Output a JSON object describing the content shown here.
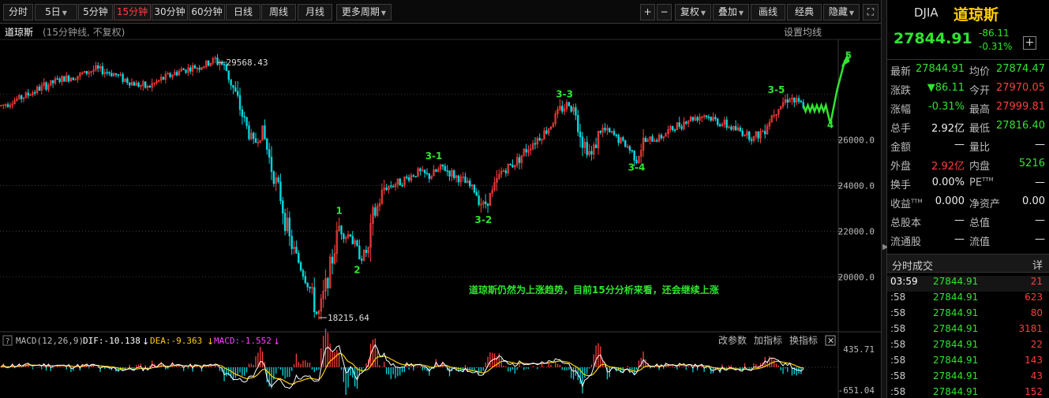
{
  "toolbar": {
    "buttons": [
      "分时",
      "5日",
      "5分钟",
      "15分钟",
      "30分钟",
      "60分钟",
      "日线",
      "周线",
      "月线",
      "更多周期"
    ],
    "right": [
      "+",
      "−",
      "复权",
      "叠加",
      "画线",
      "经典",
      "隐藏"
    ]
  },
  "chart": {
    "title": "道琼斯",
    "sub": "(15分钟线, 不复权)",
    "set_ma": "设置均线"
  },
  "chart_data": {
    "type": "candlestick",
    "y_ticks": [
      "26000.0",
      "24000.0",
      "22000.0",
      "20000.0"
    ],
    "ylim": [
      17700,
      30300
    ],
    "high_label": "29568.43",
    "low_label": "18215.64",
    "path": [
      [
        0,
        27500
      ],
      [
        5,
        27700
      ],
      [
        10,
        27900
      ],
      [
        18,
        28300
      ],
      [
        25,
        28600
      ],
      [
        35,
        28850
      ],
      [
        42,
        29100
      ],
      [
        50,
        28900
      ],
      [
        58,
        28500
      ],
      [
        65,
        28300
      ],
      [
        72,
        28700
      ],
      [
        80,
        29050
      ],
      [
        90,
        29250
      ],
      [
        96,
        29568
      ],
      [
        100,
        29050
      ],
      [
        104,
        28000
      ],
      [
        108,
        26800
      ],
      [
        112,
        25800
      ],
      [
        116,
        26400
      ],
      [
        120,
        24800
      ],
      [
        124,
        23500
      ],
      [
        128,
        21600
      ],
      [
        131,
        20900
      ],
      [
        134,
        20200
      ],
      [
        137,
        19500
      ],
      [
        140,
        18400
      ],
      [
        141,
        18216
      ],
      [
        144,
        19600
      ],
      [
        147,
        20800
      ],
      [
        150,
        22200
      ],
      [
        153,
        21800
      ],
      [
        155,
        21900
      ],
      [
        157,
        21300
      ],
      [
        160,
        20900
      ],
      [
        163,
        21200
      ],
      [
        165,
        22500
      ],
      [
        170,
        23900
      ],
      [
        178,
        24200
      ],
      [
        185,
        24600
      ],
      [
        190,
        24400
      ],
      [
        196,
        24800
      ],
      [
        200,
        24500
      ],
      [
        205,
        24200
      ],
      [
        210,
        23800
      ],
      [
        214,
        23100
      ],
      [
        218,
        23700
      ],
      [
        222,
        24600
      ],
      [
        228,
        25000
      ],
      [
        235,
        25800
      ],
      [
        242,
        26400
      ],
      [
        248,
        27300
      ],
      [
        252,
        27600
      ],
      [
        255,
        27200
      ],
      [
        258,
        26000
      ],
      [
        262,
        25300
      ],
      [
        266,
        26500
      ],
      [
        272,
        26200
      ],
      [
        278,
        25700
      ],
      [
        282,
        25200
      ],
      [
        285,
        25900
      ],
      [
        292,
        26100
      ],
      [
        298,
        26500
      ],
      [
        305,
        26900
      ],
      [
        312,
        27100
      ],
      [
        318,
        26800
      ],
      [
        325,
        26500
      ],
      [
        330,
        26300
      ],
      [
        334,
        26100
      ],
      [
        338,
        26400
      ],
      [
        344,
        27400
      ],
      [
        350,
        27900
      ],
      [
        352,
        27700
      ],
      [
        356,
        27500
      ]
    ],
    "wave_labels": [
      {
        "t": "1",
        "i": 150,
        "v": 22900
      },
      {
        "t": "2",
        "i": 158,
        "v": 20300
      },
      {
        "t": "3-1",
        "i": 192,
        "v": 25300
      },
      {
        "t": "3-2",
        "i": 214,
        "v": 22500
      },
      {
        "t": "3-3",
        "i": 250,
        "v": 28000
      },
      {
        "t": "3-4",
        "i": 282,
        "v": 24800
      },
      {
        "t": "3-5",
        "i": 344,
        "v": 28200
      },
      {
        "t": "4",
        "i": 368,
        "v": 26650
      },
      {
        "t": "5",
        "i": 376,
        "v": 29700
      }
    ],
    "annotation": "道琼斯仍然为上涨趋势，目前15分分析来看，还会继续上涨",
    "macd": {
      "label": "MACD(12,26,9)",
      "dif": "DIF:-10.138",
      "dea": "DEA:-9.363",
      "macd": "MACD:-1.552",
      "top": "435.71",
      "bottom": "-651.04"
    }
  },
  "macd_ctrl": [
    "改参数",
    "加指标",
    "换指标"
  ],
  "quote": {
    "code": "DJIA",
    "name": "道琼斯",
    "price": "27844.91",
    "chg": "-86.11",
    "pct": "-0.31%",
    "plus": "+"
  },
  "stats": [
    {
      "l1": "最新",
      "v1": "27844.91",
      "c1": "g",
      "l2": "均价",
      "v2": "27874.47",
      "c2": "g"
    },
    {
      "l1": "涨跌",
      "v1": "▼86.11",
      "c1": "g",
      "l2": "今开",
      "v2": "27970.05",
      "c2": "r"
    },
    {
      "l1": "涨幅",
      "v1": "-0.31%",
      "c1": "g",
      "l2": "最高",
      "v2": "27999.81",
      "c2": "r"
    },
    {
      "l1": "总手",
      "v1": "2.92亿",
      "c1": "w",
      "l2": "最低",
      "v2": "27816.40",
      "c2": "g"
    },
    {
      "l1": "金额",
      "v1": "—",
      "c1": "w",
      "l2": "量比",
      "v2": "—",
      "c2": "w"
    },
    {
      "l1": "外盘",
      "v1": "2.92亿",
      "c1": "r",
      "l2": "内盘",
      "v2": "5216",
      "c2": "g"
    },
    {
      "l1": "换手",
      "v1": "0.00%",
      "c1": "w",
      "l2": "PE",
      "v2": "—",
      "c2": "w"
    },
    {
      "l1": "收益",
      "v1": "0.000",
      "c1": "w",
      "l2": "净资产",
      "v2": "0.00",
      "c2": "w"
    },
    {
      "l1": "总股本",
      "v1": "—",
      "c1": "w",
      "l2": "总值",
      "v2": "—",
      "c2": "w"
    },
    {
      "l1": "流通股",
      "v1": "—",
      "c1": "w",
      "l2": "流值",
      "v2": "—",
      "c2": "w"
    }
  ],
  "ttm": "TTM",
  "trades_title": "分时成交",
  "trades_detail": "详",
  "trades": [
    {
      "t": "03:59",
      "p": "27844.91",
      "v": "21",
      "c": "r"
    },
    {
      "t": ":58",
      "p": "27844.91",
      "v": "623",
      "c": "r"
    },
    {
      "t": ":58",
      "p": "27844.91",
      "v": "80",
      "c": "r"
    },
    {
      "t": ":58",
      "p": "27844.91",
      "v": "3181",
      "c": "r"
    },
    {
      "t": ":58",
      "p": "27844.91",
      "v": "22",
      "c": "r"
    },
    {
      "t": ":58",
      "p": "27844.91",
      "v": "143",
      "c": "r"
    },
    {
      "t": ":58",
      "p": "27844.91",
      "v": "43",
      "c": "r"
    },
    {
      "t": ":58",
      "p": "27844.91",
      "v": "152",
      "c": "r"
    }
  ],
  "colors": {
    "up": "#ff3d3d",
    "down": "#00d8e0",
    "wave": "#2fe52f",
    "dif": "#ffffff",
    "dea": "#ffd000",
    "macd": "#ff40ff"
  }
}
